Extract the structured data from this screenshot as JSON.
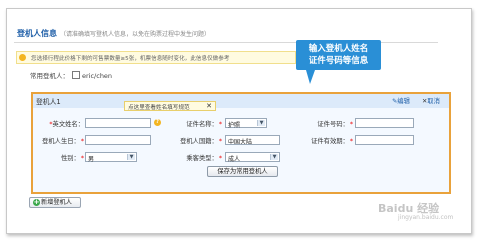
{
  "section": {
    "title": "登机人信息",
    "hint": "（请准确填写登机人信息，以免在购票过程中发生问题）"
  },
  "notice": "您选择行程此价格下剩的可售票数量≥5张，机票信息随时变化，此信息仅做参考",
  "common": {
    "label": "常用登机人：",
    "option": "eric/chen"
  },
  "callout": {
    "line1": "输入登机人姓名",
    "line2": "证件号码等信息"
  },
  "panel": {
    "title": "登机人1",
    "tip": "点这里查看姓名填写规范",
    "edit": "编辑",
    "cancel": "取消",
    "fields": {
      "en_name": {
        "label": "英文姓名：",
        "value": ""
      },
      "id_type": {
        "label": "证件名称：",
        "value": "护照"
      },
      "id_no": {
        "label": "证件号码：",
        "value": ""
      },
      "birthday": {
        "label": "登机人生日：",
        "value": ""
      },
      "nationality": {
        "label": "登机人国籍：",
        "value": "中国大陆"
      },
      "expiry": {
        "label": "证件有效期：",
        "value": ""
      },
      "gender": {
        "label": "性别：",
        "value": "男"
      },
      "passenger_type": {
        "label": "乘客类型：",
        "value": "成人"
      }
    },
    "save_label": "保存为常用登机人"
  },
  "add_label": "新增登机人",
  "watermark": {
    "main": "Baidu 经验",
    "sub": "jingyan.baidu.com"
  },
  "colors": {
    "accent": "#1f5fa8",
    "callout": "#2a8fd6",
    "highlight": "#e9a23b"
  }
}
